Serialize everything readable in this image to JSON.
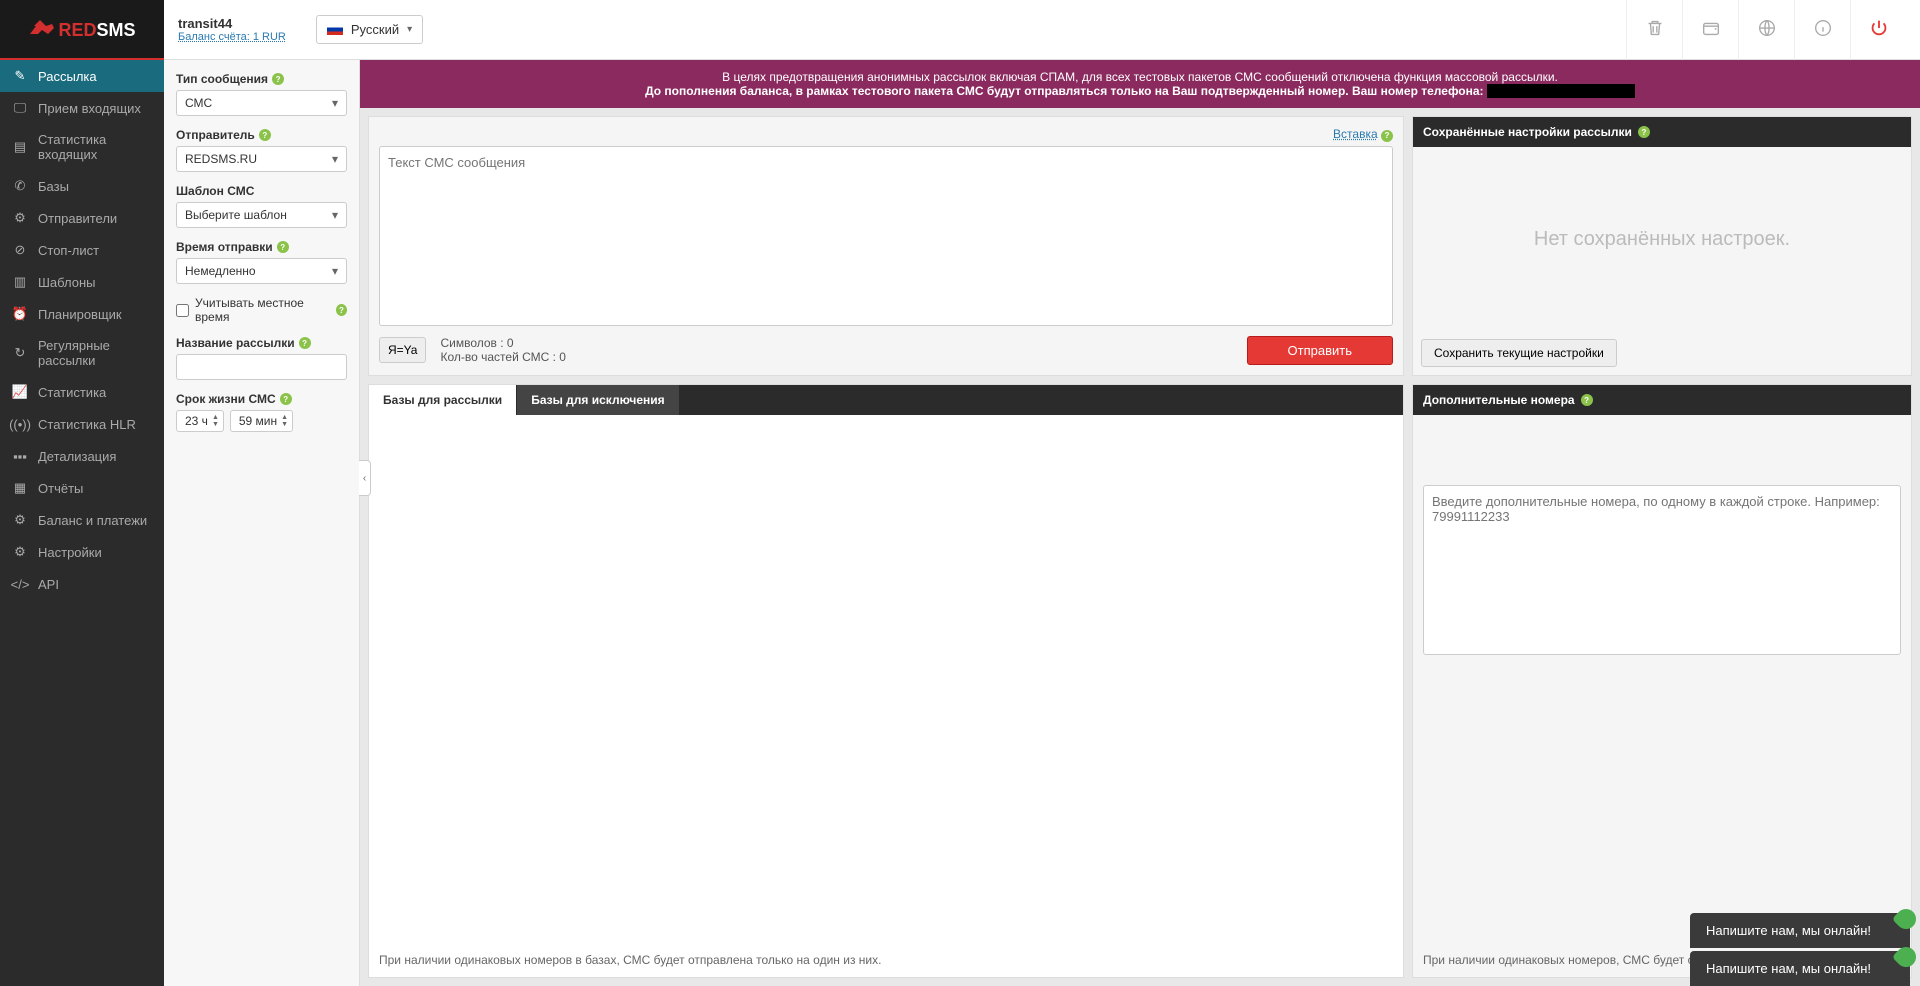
{
  "logo": {
    "red": "RED",
    "sms": "SMS"
  },
  "user": {
    "name": "transit44",
    "balance_label": "Баланс счёта: 1 RUR"
  },
  "lang": {
    "label": "Русский"
  },
  "nav": [
    {
      "id": "send",
      "label": "Рассылка",
      "active": true
    },
    {
      "id": "inbox",
      "label": "Прием входящих"
    },
    {
      "id": "inbox-stats",
      "label": "Статистика входящих"
    },
    {
      "id": "bases",
      "label": "Базы"
    },
    {
      "id": "senders",
      "label": "Отправители"
    },
    {
      "id": "stoplist",
      "label": "Стоп-лист"
    },
    {
      "id": "templates",
      "label": "Шаблоны"
    },
    {
      "id": "scheduler",
      "label": "Планировщик"
    },
    {
      "id": "recurring",
      "label": "Регулярные рассылки"
    },
    {
      "id": "stats",
      "label": "Статистика"
    },
    {
      "id": "hlr",
      "label": "Статистика HLR"
    },
    {
      "id": "details",
      "label": "Детализация"
    },
    {
      "id": "reports",
      "label": "Отчёты"
    },
    {
      "id": "billing",
      "label": "Баланс и платежи"
    },
    {
      "id": "settings",
      "label": "Настройки"
    },
    {
      "id": "api",
      "label": "API"
    }
  ],
  "warning": {
    "line1": "В целях предотвращения анонимных рассылок включая СПАМ, для всех тестовых пакетов СМС сообщений отключена функция массовой рассылки.",
    "line2a": "До пополнения баланса, в рамках тестового пакета СМС будут отправляться только на Ваш подтвержденный номер. Ваш номер телефона:",
    "phone_redacted": "XXXXXXXXXXX"
  },
  "form": {
    "type_label": "Тип сообщения",
    "type_value": "СМС",
    "sender_label": "Отправитель",
    "sender_value": "REDSMS.RU",
    "template_label": "Шаблон СМС",
    "template_value": "Выберите шаблон",
    "time_label": "Время отправки",
    "time_value": "Немедленно",
    "localtime_label": "Учитывать местное время",
    "name_label": "Название рассылки",
    "name_value": "",
    "ttl_label": "Срок жизни СМС",
    "ttl_hours": "23 ч",
    "ttl_minutes": "59 мин"
  },
  "compose": {
    "insert_link": "Вставка",
    "placeholder": "Текст СМС сообщения",
    "translit_btn": "Я=Ya",
    "chars_label": "Символов : 0",
    "parts_label": "Кол-во частей СМС : 0",
    "send_btn": "Отправить"
  },
  "tabs": {
    "include": "Базы для рассылки",
    "exclude": "Базы для исключения",
    "footer": "При наличии одинаковых номеров в базах, СМС будет отправлена только на один из них."
  },
  "saved": {
    "header": "Сохранённые настройки рассылки",
    "empty": "Нет сохранённых настроек.",
    "save_btn": "Сохранить текущие настройки"
  },
  "addnum": {
    "header": "Дополнительные номера",
    "placeholder": "Введите дополнительные номера, по одному в каждой строке. Например: 79991112233",
    "footer": "При наличии одинаковых номеров, СМС будет отпра"
  },
  "chat": {
    "text": "Напишите нам, мы онлайн!"
  }
}
